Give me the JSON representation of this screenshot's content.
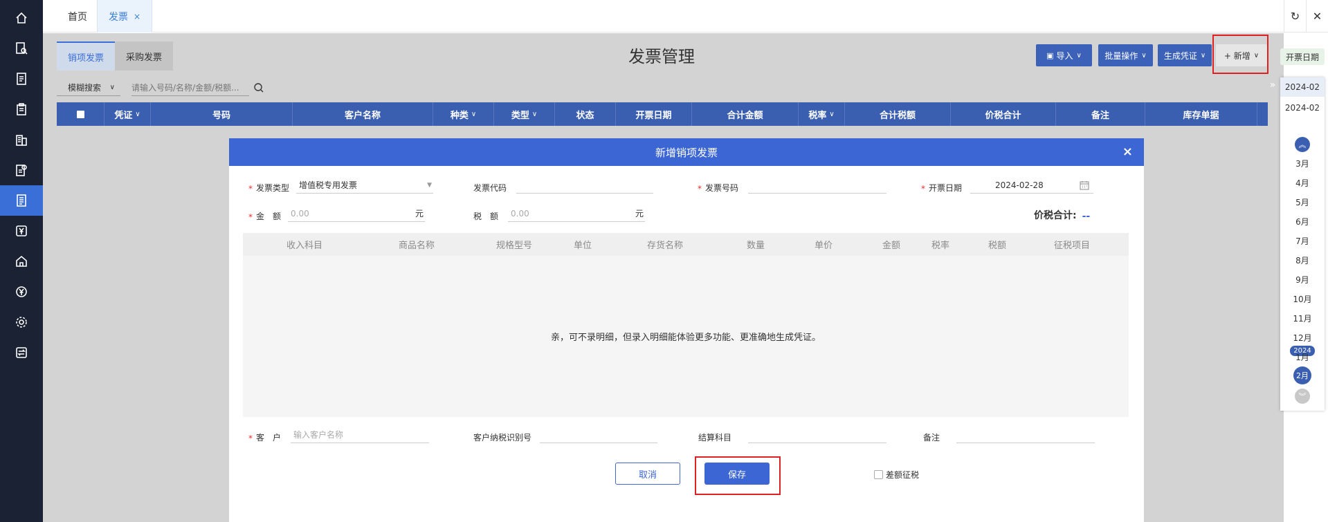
{
  "top_tabs": [
    {
      "label": "首页",
      "active": false
    },
    {
      "label": "发票",
      "active": true,
      "close": "×"
    }
  ],
  "top_icons": {
    "refresh": "↻",
    "close": "✕"
  },
  "sidebar_icons": [
    "home-icon",
    "search-doc-icon",
    "list-icon",
    "clipboard-icon",
    "building-icon",
    "doc-settings-icon",
    "invoice-icon",
    "yen-icon",
    "warehouse-icon",
    "yen-circle-icon",
    "gear-icon",
    "transfer-icon"
  ],
  "sub_tabs": [
    "销项发票",
    "采购发票"
  ],
  "page_title": "发票管理",
  "toolbar": {
    "import": "导入",
    "batch": "批量操作",
    "voucher": "生成凭证",
    "add": "+ 新增"
  },
  "search": {
    "mode": "模糊搜索",
    "placeholder": "请输入号码/名称/金额/税额..."
  },
  "grid_headers": [
    "凭证",
    "号码",
    "客户名称",
    "种类",
    "类型",
    "状态",
    "开票日期",
    "合计金额",
    "税率",
    "合计税额",
    "价税合计",
    "备注",
    "库存单据"
  ],
  "date_panel": {
    "label": "开票日期",
    "dates": [
      "2024-02",
      "2024-02"
    ],
    "months": [
      "3月",
      "4月",
      "5月",
      "6月",
      "7月",
      "8月",
      "9月",
      "10月",
      "11月",
      "12月",
      "1月"
    ],
    "year_badge": "2024",
    "current_month": "2月"
  },
  "modal": {
    "title": "新增销项发票",
    "close": "×",
    "invoice_type_label": "发票类型",
    "invoice_type_value": "增值税专用发票",
    "invoice_code_label": "发票代码",
    "invoice_no_label": "发票号码",
    "date_label": "开票日期",
    "date_value": "2024-02-28",
    "amount_label": "金　额",
    "amount_placeholder": "0.00",
    "amount_unit": "元",
    "tax_label": "税　额",
    "tax_placeholder": "0.00",
    "tax_unit": "元",
    "total_label": "价税合计:",
    "total_value": "--",
    "detail_columns": [
      "收入科目",
      "商品名称",
      "规格型号",
      "单位",
      "存货名称",
      "数量",
      "单价",
      "金额",
      "税率",
      "税额",
      "征税项目"
    ],
    "empty_hint": "亲，可不录明细，但录入明细能体验更多功能、更准确地生成凭证。",
    "customer_label": "客　户",
    "customer_placeholder": "输入客户名称",
    "customer_tax_id_label": "客户纳税识别号",
    "settle_account_label": "结算科目",
    "remark_label": "备注",
    "cancel": "取消",
    "save": "保存",
    "diff_tax": "差额征税"
  },
  "colors": {
    "sidebar": "#1a2233",
    "accent": "#3b66d4",
    "grid_header": "#3b5fb0",
    "highlight": "#e02020"
  }
}
